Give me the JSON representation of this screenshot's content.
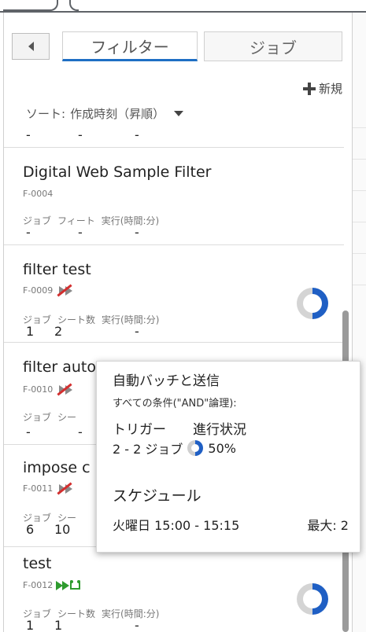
{
  "tabs": {
    "filter_label": "フィルター",
    "jobs_label": "ジョブ"
  },
  "toolbar": {
    "new_label": "新規"
  },
  "sort": {
    "label": "ソート:",
    "value": "作成時刻（昇順）"
  },
  "cards": [
    {
      "name": "",
      "code": "",
      "headers": [
        "",
        "",
        ""
      ],
      "values": [
        "-",
        "-",
        "-"
      ],
      "progress": null
    },
    {
      "name": "Digital Web Sample Filter",
      "code": "F-0004",
      "headers": [
        "ジョブ",
        "フィート",
        "実行(時間:分)"
      ],
      "values": [
        "-",
        "-",
        "-"
      ],
      "progress": null
    },
    {
      "name": "filter test",
      "code": "F-0009",
      "headers": [
        "ジョブ",
        "シート数",
        "実行(時間:分)"
      ],
      "values": [
        "1",
        "2",
        "-"
      ],
      "progress": 0.5
    },
    {
      "name": "filter automation",
      "code": "F-0010",
      "headers": [
        "ジョブ",
        "シー"
      ],
      "values": [
        "-",
        "-"
      ],
      "progress": null
    },
    {
      "name": "impose c",
      "code": "F-0011",
      "headers": [
        "ジョブ",
        "シー"
      ],
      "values": [
        "6",
        "10"
      ],
      "progress": null
    },
    {
      "name": "test",
      "code": "F-0012",
      "headers": [
        "ジョブ",
        "シート数",
        "実行(時間:分)"
      ],
      "values": [
        "1",
        "1",
        "-"
      ],
      "progress": 0.5
    }
  ],
  "popup": {
    "title": "自動バッチと送信",
    "subtitle": "すべての条件(\"AND\"論理):",
    "trigger_label": "トリガー",
    "progress_label": "進行状況",
    "jobs_range": "2 - 2 ジョブ",
    "progress_value": "50%",
    "schedule_label": "スケジュール",
    "schedule_time": "火曜日 15:00 - 15:15",
    "max_label": "最大: 2"
  },
  "colors": {
    "accent": "#1f5fc4",
    "donut_track": "#d4d4d4",
    "active_icon": "#2e9b2e",
    "disabled_slash": "#d32f2f"
  }
}
